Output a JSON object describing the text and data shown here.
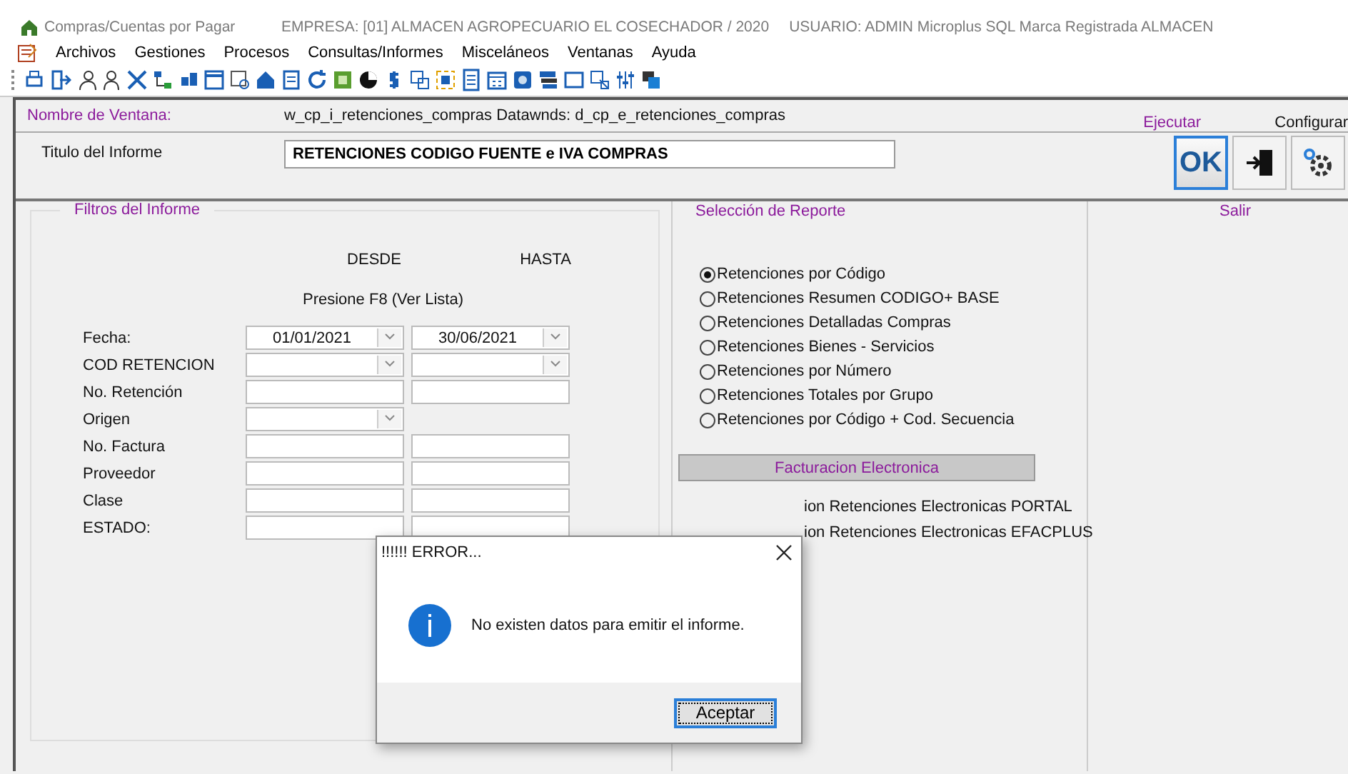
{
  "header": {
    "app_title": "Compras/Cuentas por Pagar",
    "company": "EMPRESA:  [01] ALMACEN AGROPECUARIO EL COSECHADOR / 2020",
    "user": "USUARIO: ADMIN  Microplus SQL Marca Registrada ALMACEN"
  },
  "menu": [
    "Archivos",
    "Gestiones",
    "Procesos",
    "Consultas/Informes",
    "Misceláneos",
    "Ventanas",
    "Ayuda"
  ],
  "window_info": {
    "label": "Nombre de Ventana:",
    "value": "w_cp_i_retenciones_compras  Datawnds:  d_cp_e_retenciones_compras"
  },
  "actions": {
    "execute_label": "Ejecutar",
    "configure_label": "Configurar",
    "ok_button": "OK",
    "exit_label": "Salir"
  },
  "report_title": {
    "label": "Titulo del Informe",
    "value": "RETENCIONES CODIGO FUENTE e IVA COMPRAS"
  },
  "filters": {
    "title": "Filtros del Informe",
    "from_heading": "DESDE",
    "to_heading": "HASTA",
    "hint": "Presione F8  (Ver Lista)",
    "rows": [
      {
        "label": "Fecha:",
        "from": {
          "kind": "dropdown",
          "value": "01/01/2021"
        },
        "to": {
          "kind": "dropdown",
          "value": "30/06/2021"
        }
      },
      {
        "label": "COD RETENCION",
        "from": {
          "kind": "dropdown"
        },
        "to": {
          "kind": "dropdown"
        }
      },
      {
        "label": "No. Retención",
        "from": {
          "kind": "text"
        },
        "to": {
          "kind": "text"
        }
      },
      {
        "label": "Origen",
        "from": {
          "kind": "dropdown"
        }
      },
      {
        "label": "No. Factura",
        "from": {
          "kind": "text"
        },
        "to": {
          "kind": "text"
        }
      },
      {
        "label": "Proveedor",
        "from": {
          "kind": "text"
        },
        "to": {
          "kind": "text"
        }
      },
      {
        "label": "Clase",
        "from": {
          "kind": "text"
        },
        "to": {
          "kind": "text"
        }
      },
      {
        "label": "ESTADO:",
        "from": {
          "kind": "text"
        },
        "to": {
          "kind": "text"
        }
      }
    ]
  },
  "report_selection": {
    "title": "Selección de Reporte",
    "options": [
      {
        "label": "Retenciones por Código",
        "selected": true
      },
      {
        "label": "Retenciones Resumen CODIGO+ BASE",
        "selected": false
      },
      {
        "label": "Retenciones Detalladas Compras",
        "selected": false
      },
      {
        "label": "Retenciones Bienes - Servicios",
        "selected": false
      },
      {
        "label": "Retenciones por Número",
        "selected": false
      },
      {
        "label": "Retenciones Totales por Grupo",
        "selected": false
      },
      {
        "label": "Retenciones por Código  + Cod. Secuencia",
        "selected": false
      }
    ]
  },
  "electronic": {
    "title": "Facturacion Electronica",
    "options": [
      "ion Retenciones Electronicas PORTAL",
      "ion Retenciones Electronicas EFACPLUS"
    ]
  },
  "dialog": {
    "title": "!!!!!! ERROR...",
    "message": "No existen datos para emitir el informe.",
    "button": "Aceptar"
  }
}
